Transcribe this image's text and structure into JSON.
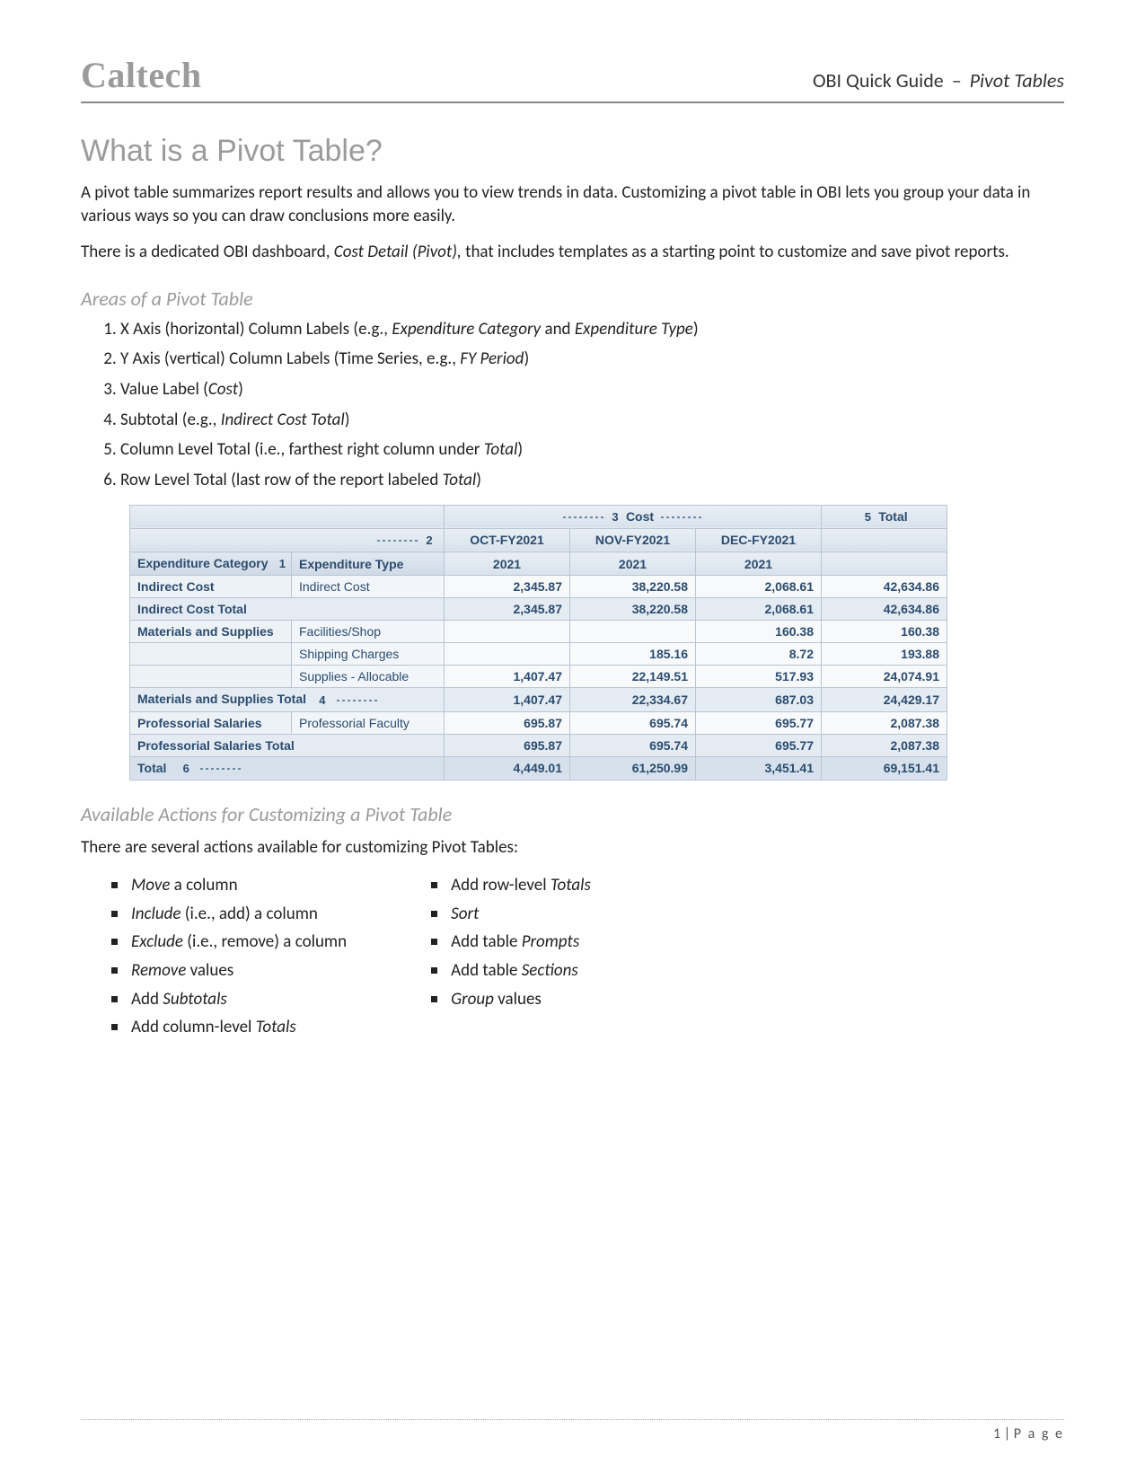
{
  "header": {
    "brand": "Caltech",
    "doc_title_a": "OBI Quick Guide",
    "doc_title_dash": "–",
    "doc_title_b": "Pivot Tables"
  },
  "section1": {
    "heading": "What is a Pivot Table?",
    "para1_a": "A pivot table summarizes report results and allows you to view trends in data. Customizing a pivot table in OBI lets you group your data in various ways so you can draw conclusions more easily.",
    "para2_a": "There is a dedicated OBI dashboard, ",
    "para2_i": "Cost Detail (Pivot),",
    "para2_b": " that includes templates as a starting point to customize and save pivot reports."
  },
  "areas": {
    "heading": "Areas of a Pivot Table",
    "items": [
      {
        "a": "X Axis (horizontal) Column Labels (e.g., ",
        "i": "Expenditure Category",
        "b": " and ",
        "i2": "Expenditure Type",
        "c": ")"
      },
      {
        "a": "Y Axis (vertical) Column Labels (Time Series, e.g., ",
        "i": "FY Period",
        "c": ")"
      },
      {
        "a": "Value Label (",
        "i": "Cost",
        "c": ")"
      },
      {
        "a": "Subtotal (e.g., ",
        "i": "Indirect Cost Total",
        "c": ")"
      },
      {
        "a": "Column Level Total (i.e., farthest right column under ",
        "i": "Total",
        "c": ")"
      },
      {
        "a": "Row Level Total (last row of the report labeled ",
        "i": "Total",
        "c": ")"
      }
    ]
  },
  "pivot": {
    "callouts": {
      "c1": "1",
      "c2": "2",
      "c3": "3",
      "c4": "4",
      "c5": "5",
      "c6": "6"
    },
    "header_cost": "Cost",
    "header_total": "Total",
    "periods": [
      "OCT-FY2021",
      "NOV-FY2021",
      "DEC-FY2021"
    ],
    "years": [
      "2021",
      "2021",
      "2021"
    ],
    "col_exp_cat": "Expenditure Category",
    "col_exp_type": "Expenditure Type",
    "rows": [
      {
        "cat": "Indirect Cost",
        "type": "Indirect Cost",
        "v": [
          "2,345.87",
          "38,220.58",
          "2,068.61",
          "42,634.86"
        ]
      },
      {
        "subtotal": "Indirect Cost Total",
        "v": [
          "2,345.87",
          "38,220.58",
          "2,068.61",
          "42,634.86"
        ]
      },
      {
        "cat": "Materials and Supplies",
        "type": "Facilities/Shop",
        "v": [
          "",
          "",
          "160.38",
          "160.38"
        ]
      },
      {
        "cat": "",
        "type": "Shipping Charges",
        "v": [
          "",
          "185.16",
          "8.72",
          "193.88"
        ]
      },
      {
        "cat": "",
        "type": "Supplies - Allocable",
        "v": [
          "1,407.47",
          "22,149.51",
          "517.93",
          "24,074.91"
        ]
      },
      {
        "subtotal": "Materials and Supplies Total",
        "callout": "4",
        "v": [
          "1,407.47",
          "22,334.67",
          "687.03",
          "24,429.17"
        ]
      },
      {
        "cat": "Professorial Salaries",
        "type": "Professorial Faculty",
        "v": [
          "695.87",
          "695.74",
          "695.77",
          "2,087.38"
        ]
      },
      {
        "subtotal": "Professorial Salaries Total",
        "v": [
          "695.87",
          "695.74",
          "695.77",
          "2,087.38"
        ]
      },
      {
        "grand": "Total",
        "callout": "6",
        "v": [
          "4,449.01",
          "61,250.99",
          "3,451.41",
          "69,151.41"
        ]
      }
    ]
  },
  "actions": {
    "heading": "Available Actions for Customizing a Pivot Table",
    "intro": "There are several actions available for customizing Pivot Tables:",
    "left": [
      {
        "i": "Move",
        "t": " a column"
      },
      {
        "i": "Include",
        "t": " (i.e., add) a column"
      },
      {
        "i": "Exclude",
        "t": " (i.e., remove) a column"
      },
      {
        "i": "Remove",
        "t": " values"
      },
      {
        "p": "Add ",
        "i": "Subtotals",
        "t": ""
      },
      {
        "p": "Add column-level ",
        "i": "Totals",
        "t": ""
      }
    ],
    "right": [
      {
        "p": "Add row-level ",
        "i": "Totals",
        "t": ""
      },
      {
        "i": "Sort",
        "t": ""
      },
      {
        "p": "Add table ",
        "i": "Prompts",
        "t": ""
      },
      {
        "p": "Add table ",
        "i": "Sections",
        "t": ""
      },
      {
        "i": "Group",
        "t": " values"
      }
    ]
  },
  "footer": {
    "num": "1",
    "sep": " | ",
    "label": "P a g e"
  }
}
